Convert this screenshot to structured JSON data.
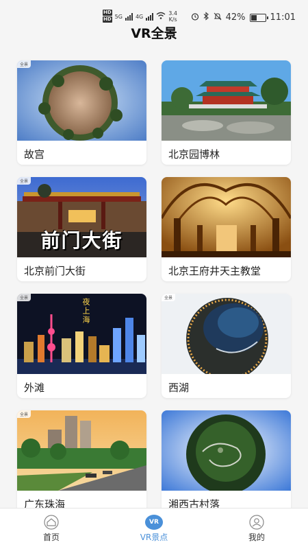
{
  "status_bar": {
    "hd1": "HD",
    "hd2": "HD",
    "net5g": "5G",
    "net4g": "4G",
    "speed_value": "3.4",
    "speed_unit": "K/s",
    "battery_percent": "42%",
    "battery_level": 0.42,
    "time": "11:01"
  },
  "header": {
    "title": "VR全景"
  },
  "cards": [
    {
      "title": "故宫",
      "tag": "全景",
      "icon": "little-planet-courtyard"
    },
    {
      "title": "北京园博林",
      "tag": "",
      "icon": "chinese-pavilion"
    },
    {
      "title": "北京前门大街",
      "tag": "全景",
      "icon": "qianmen-archway",
      "overlay": "前门大街"
    },
    {
      "title": "北京王府井天主教堂",
      "tag": "",
      "icon": "church-vaulted-ceiling"
    },
    {
      "title": "外滩",
      "tag": "全景",
      "icon": "shanghai-night-skyline",
      "overlay_vertical": "夜上海"
    },
    {
      "title": "西湖",
      "tag": "全景",
      "icon": "little-planet-lake"
    },
    {
      "title": "广东珠海",
      "tag": "全景",
      "icon": "city-boulevard"
    },
    {
      "title": "湘西古村落",
      "tag": "",
      "icon": "little-planet-mountain"
    }
  ],
  "bottom_nav": [
    {
      "label": "首页",
      "icon": "home-icon",
      "active": false
    },
    {
      "label": "VR景点",
      "icon": "vr-icon",
      "active": true,
      "icon_text": "VR"
    },
    {
      "label": "我的",
      "icon": "user-icon",
      "active": false
    }
  ],
  "colors": {
    "accent": "#4a90d9",
    "background": "#f5f5f5"
  }
}
